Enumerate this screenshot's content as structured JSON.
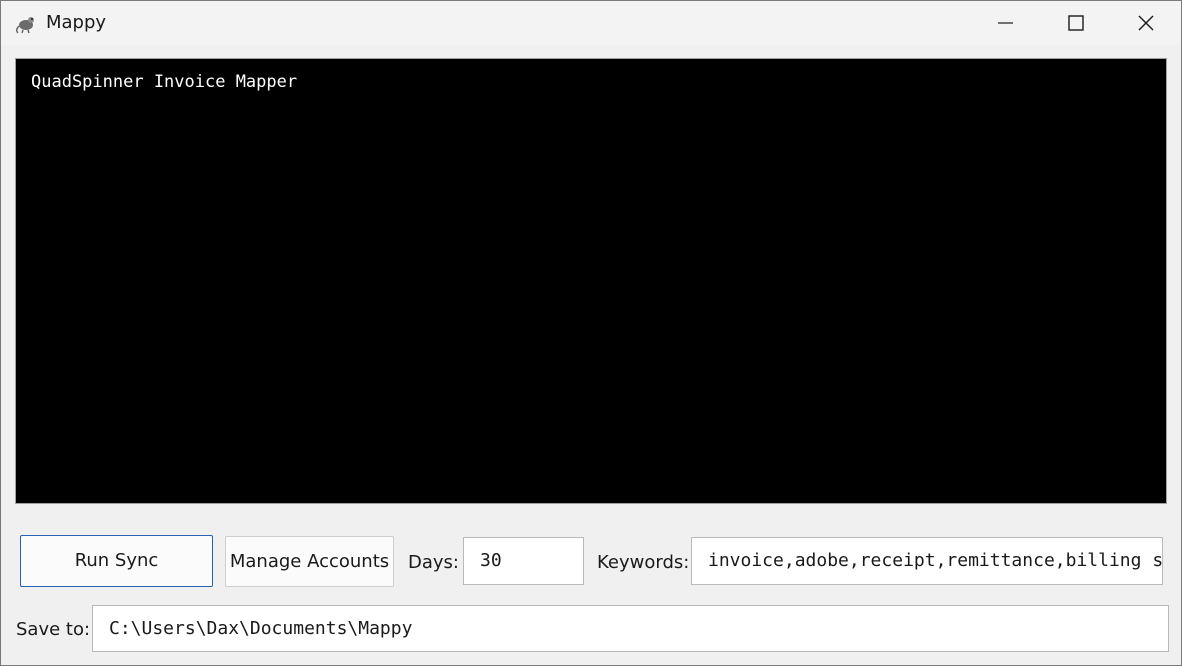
{
  "window": {
    "title": "Mappy",
    "app_icon": "mouse-icon"
  },
  "titlebar": {
    "minimize_icon": "minimize-icon",
    "maximize_icon": "maximize-icon",
    "close_icon": "close-icon"
  },
  "console": {
    "text": "QuadSpinner Invoice Mapper"
  },
  "toolbar": {
    "run_sync_label": "Run Sync",
    "manage_accounts_label": "Manage Accounts",
    "days_label": "Days:",
    "days_value": "30",
    "keywords_label": "Keywords:",
    "keywords_value": "invoice,adobe,receipt,remittance,billing stat"
  },
  "save": {
    "label": "Save to:",
    "path": "C:\\Users\\Dax\\Documents\\Mappy"
  },
  "colors": {
    "console_bg": "#000000",
    "console_text": "#ffffff",
    "accent_border": "#2a62b8",
    "window_bg": "#f0f0f0"
  }
}
